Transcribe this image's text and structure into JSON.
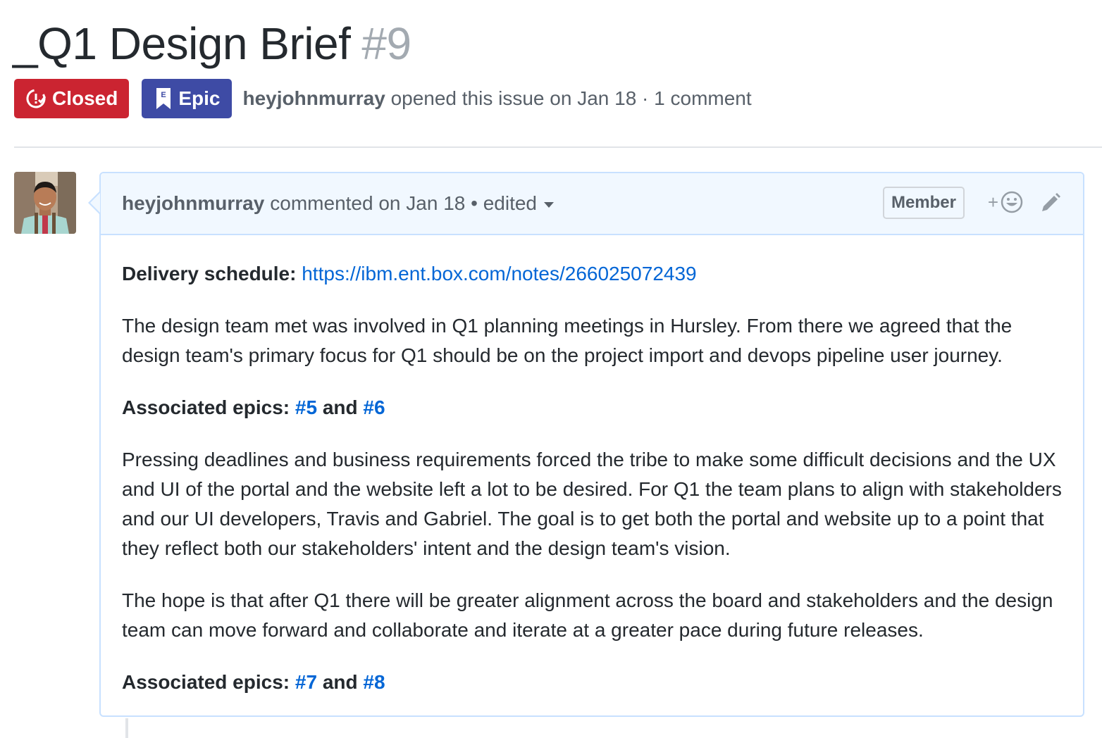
{
  "issue": {
    "title": "_Q1 Design Brief",
    "number": "#9",
    "state": "Closed",
    "label": "Epic",
    "label_icon_letter": "E",
    "author": "heyjohnmurray",
    "meta": "opened this issue on Jan 18 · 1 comment"
  },
  "comment": {
    "author": "heyjohnmurray",
    "action": "commented on Jan 18 • edited",
    "member_label": "Member",
    "reaction_plus": "+",
    "body": {
      "p1_label": "Delivery schedule:",
      "p1_link": "https://ibm.ent.box.com/notes/266025072439",
      "p2": "The design team met was involved in Q1 planning meetings in Hursley. From there we agreed that the design team's primary focus for Q1 should be on the project import and devops pipeline user journey.",
      "p3_label": "Associated epics:",
      "p3_ref1": "#5",
      "p3_and": "and",
      "p3_ref2": "#6",
      "p4": "Pressing deadlines and business requirements forced the tribe to make some difficult decisions and the UX and UI of the portal and the website left a lot to be desired. For Q1 the team plans to align with stakeholders and our UI developers, Travis and Gabriel. The goal is to get both the portal and website up to a point that they reflect both our stakeholders' intent and the design team's vision.",
      "p5": "The hope is that after Q1 there will be greater alignment across the board and stakeholders and the design team can move forward and collaborate and iterate at a greater pace during future releases.",
      "p6_label": "Associated epics:",
      "p6_ref1": "#7",
      "p6_and": "and",
      "p6_ref2": "#8"
    }
  },
  "colors": {
    "closed": "#cb2431",
    "epic": "#3e4ba5",
    "link": "#0366d6",
    "header_bg": "#f1f8ff",
    "header_border": "#c8e1ff"
  },
  "icons": {
    "state": "issue-closed-icon",
    "label": "bookmark-icon",
    "reaction": "smiley-icon",
    "edit": "pencil-icon",
    "edited_menu": "chevron-down-icon"
  }
}
